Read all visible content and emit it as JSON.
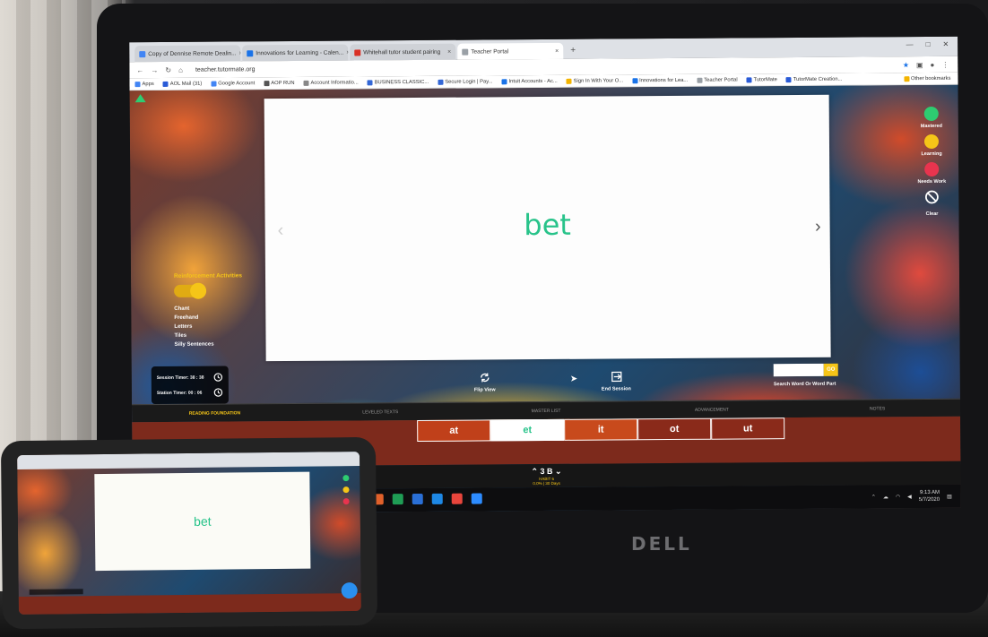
{
  "browser": {
    "tabs": [
      {
        "label": "Copy of Dennise Remote Dealin...",
        "color": "#4285f4"
      },
      {
        "label": "Innovations for Learning - Calen...",
        "color": "#1a73e8"
      },
      {
        "label": "Whitehall tutor student pairing",
        "color": "#d93025"
      },
      {
        "label": "Teacher Portal",
        "color": "#9aa0a6"
      }
    ],
    "url": "teacher.tutormate.org",
    "bookmarks": [
      "Apps",
      "AOL Mail (31)",
      "Google Account",
      "AOP RUN",
      "Account Informatio...",
      "BUSINESS CLASSIC...",
      "Secure Login | Pay...",
      "Intuit Accounts - Ac...",
      "Sign In With Your O...",
      "Innovations for Lea...",
      "Teacher Portal",
      "TutorMate",
      "TutorMate Creation..."
    ],
    "other_bookmarks": "Other bookmarks"
  },
  "card": {
    "word": "bet"
  },
  "reinforcement": {
    "title": "Reinforcement Activities",
    "items": [
      "Chant",
      "Freehand",
      "Letters",
      "Tiles",
      "Silly Sentences"
    ]
  },
  "status": {
    "mastered": {
      "label": "Mastered",
      "color": "#2ecc71"
    },
    "learning": {
      "label": "Learning",
      "color": "#f5c518"
    },
    "needs_work": {
      "label": "Needs Work",
      "color": "#e8344e"
    },
    "clear": {
      "label": "Clear"
    }
  },
  "timers": {
    "session": "Session Timer: 38 : 38",
    "station": "Station Timer: 00 : 06"
  },
  "controls": {
    "flip": "Flip View",
    "end": "End Session"
  },
  "search": {
    "go": "GO",
    "label": "Search Word Or Word Part"
  },
  "nav_tabs": [
    "READING FOUNDATION",
    "LEVELED TEXTS",
    "MASTER LIST",
    "ADVANCEMENT",
    "NOTES"
  ],
  "tiles": [
    "at",
    "et",
    "it",
    "ot",
    "ut"
  ],
  "level": {
    "main": "3 B",
    "sub1": "HABIT 6",
    "sub2": "0.0% | 30 Days"
  },
  "taskbar": {
    "time": "9:13 AM",
    "date": "5/7/2020"
  },
  "monitor_brand": "DELL",
  "phone": {
    "word": "bet"
  }
}
